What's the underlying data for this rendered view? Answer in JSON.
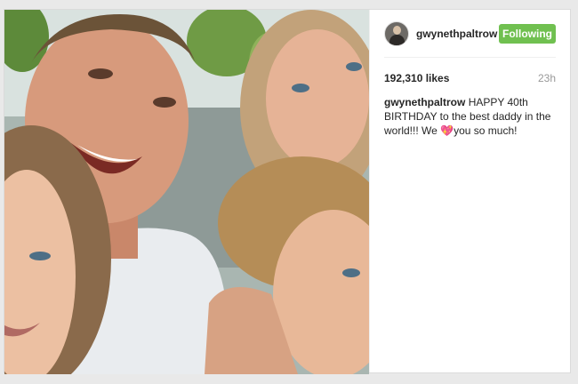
{
  "post": {
    "username": "gwynethpaltrow",
    "follow_label": "Following",
    "likes": "192,310 likes",
    "time": "23h",
    "caption_user": "gwynethpaltrow",
    "caption_text_1": "HAPPY 40th BIRTHDAY to the best daddy in the world!!! We ",
    "caption_heart": "💖",
    "caption_text_2": "you so much!"
  },
  "colors": {
    "follow_button": "#70c050",
    "username": "#262626",
    "timestamp": "#999999"
  },
  "icons": {
    "avatar": "profile-avatar",
    "heart": "heart-emoji"
  }
}
